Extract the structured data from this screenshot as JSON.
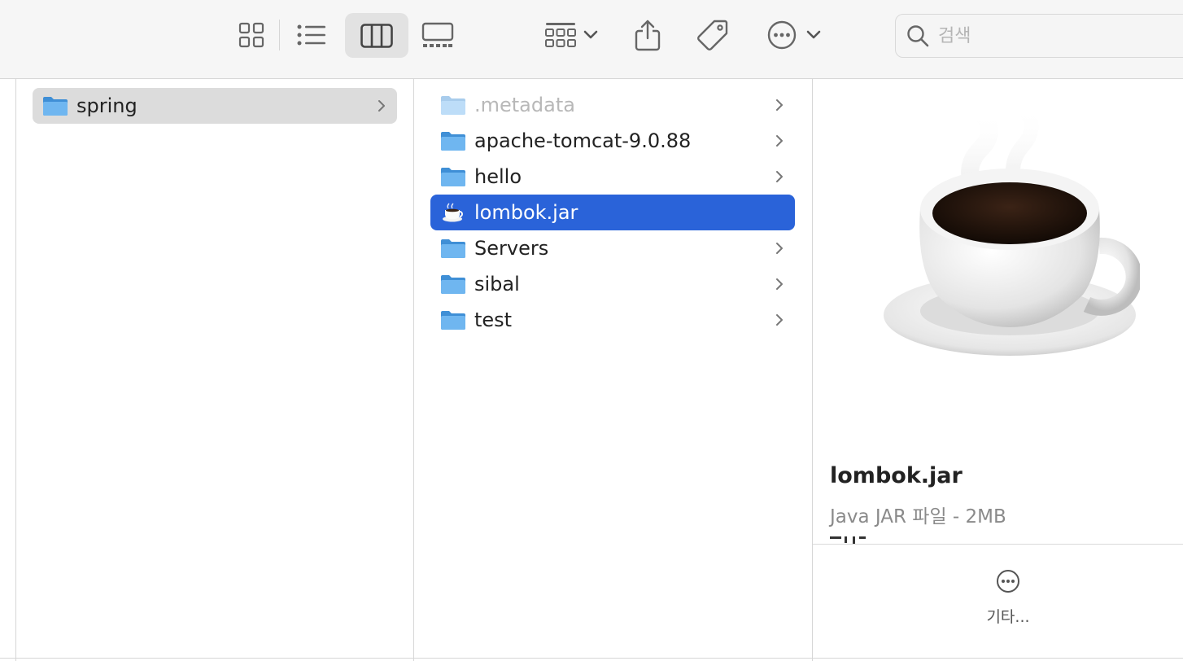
{
  "toolbar": {
    "view_modes": [
      {
        "name": "icon-view",
        "icon": "grid-icon",
        "selected": false
      },
      {
        "name": "list-view",
        "icon": "list-icon",
        "selected": false
      },
      {
        "name": "column-view",
        "icon": "columns-icon",
        "selected": true
      },
      {
        "name": "gallery-view",
        "icon": "gallery-icon",
        "selected": false
      }
    ],
    "group_icon": "group-by-icon",
    "share_icon": "share-icon",
    "tag_icon": "tag-icon",
    "more_icon": "ellipsis-circle-icon",
    "search": {
      "placeholder": "검색",
      "value": ""
    }
  },
  "columns": {
    "first": [
      {
        "label": "spring",
        "icon": "folder-icon",
        "has_children": true,
        "state": "parent-selected"
      }
    ],
    "second": [
      {
        "label": ".metadata",
        "icon": "folder-icon",
        "has_children": true,
        "state": "dim"
      },
      {
        "label": "apache-tomcat-9.0.88",
        "icon": "folder-icon",
        "has_children": true,
        "state": "normal"
      },
      {
        "label": "hello",
        "icon": "folder-icon",
        "has_children": true,
        "state": "normal"
      },
      {
        "label": "lombok.jar",
        "icon": "java-jar-icon",
        "has_children": false,
        "state": "selected"
      },
      {
        "label": "Servers",
        "icon": "folder-icon",
        "has_children": true,
        "state": "normal"
      },
      {
        "label": "sibal",
        "icon": "folder-icon",
        "has_children": true,
        "state": "normal"
      },
      {
        "label": "test",
        "icon": "folder-icon",
        "has_children": true,
        "state": "normal"
      }
    ]
  },
  "preview": {
    "image": "coffee-cup-icon",
    "name": "lombok.jar",
    "kind": "Java JAR 파일 - 2MB",
    "more_label": "기타..."
  },
  "colors": {
    "selection": "#2a63d9",
    "parent_selection": "#dcdcdc",
    "folder": "#5aa8ea",
    "toolbar_bg": "#f6f6f6"
  }
}
